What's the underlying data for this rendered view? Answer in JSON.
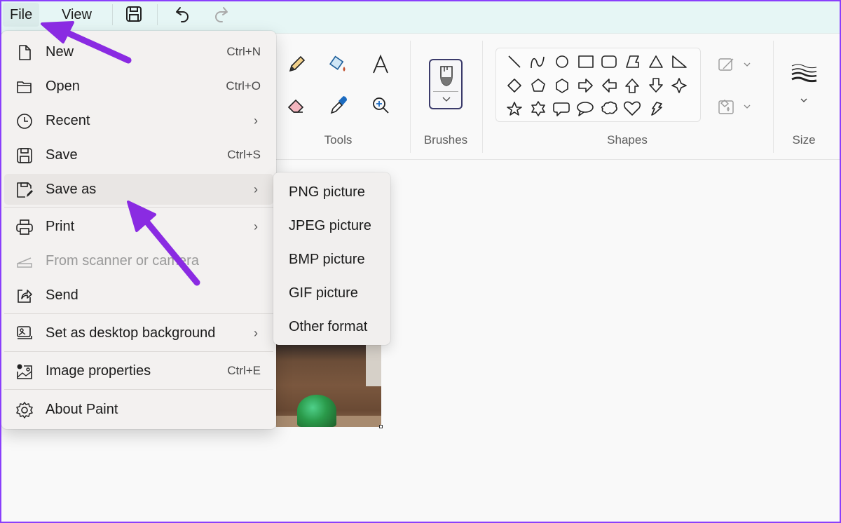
{
  "menubar": {
    "file_label": "File",
    "view_label": "View",
    "quick_access": [
      "save-icon",
      "undo-icon",
      "redo-icon"
    ]
  },
  "ribbon": {
    "groups": {
      "tools": {
        "label": "Tools",
        "items": [
          "pencil",
          "fill",
          "text",
          "eraser",
          "color-picker",
          "magnifier"
        ]
      },
      "brushes": {
        "label": "Brushes"
      },
      "shapes": {
        "label": "Shapes",
        "items": [
          "line",
          "curve",
          "oval",
          "rectangle",
          "rounded-rectangle",
          "polygon",
          "triangle",
          "right-triangle",
          "diamond",
          "pentagon",
          "hexagon",
          "right-arrow",
          "left-arrow",
          "up-arrow",
          "down-arrow",
          "four-point-star",
          "five-point-star",
          "six-point-star",
          "rounded-rectangular-callout",
          "oval-callout",
          "cloud-callout",
          "heart",
          "lightning"
        ]
      },
      "size": {
        "label": "Size"
      }
    }
  },
  "file_menu": {
    "items": [
      {
        "label": "New",
        "shortcut": "Ctrl+N",
        "icon": "new-file-icon"
      },
      {
        "label": "Open",
        "shortcut": "Ctrl+O",
        "icon": "folder-icon"
      },
      {
        "label": "Recent",
        "submenu": true,
        "icon": "clock-icon"
      },
      {
        "label": "Save",
        "shortcut": "Ctrl+S",
        "icon": "save-icon"
      },
      {
        "label": "Save as",
        "submenu": true,
        "icon": "save-as-icon",
        "highlighted": true
      },
      {
        "label": "Print",
        "submenu": true,
        "icon": "printer-icon"
      },
      {
        "label": "From scanner or camera",
        "disabled": true,
        "icon": "scanner-icon"
      },
      {
        "label": "Send",
        "icon": "share-icon"
      },
      {
        "label": "Set as desktop background",
        "submenu": true,
        "icon": "desktop-background-icon"
      },
      {
        "label": "Image properties",
        "shortcut": "Ctrl+E",
        "icon": "image-properties-icon"
      },
      {
        "label": "About Paint",
        "icon": "gear-icon"
      }
    ]
  },
  "save_as_submenu": {
    "items": [
      "PNG picture",
      "JPEG picture",
      "BMP picture",
      "GIF picture",
      "Other format"
    ]
  },
  "colors": {
    "menubar_bg": "#e6f6f5",
    "annotation_arrow": "#8a2be2",
    "frame": "#8a3ffc"
  }
}
